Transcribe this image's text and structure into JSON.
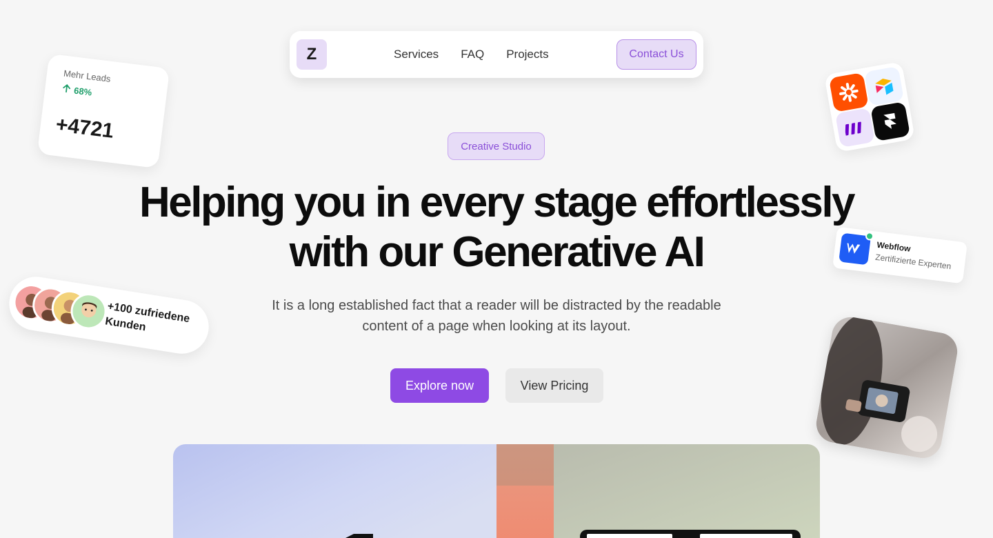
{
  "nav": {
    "logo_letter": "Z",
    "links": [
      "Services",
      "FAQ",
      "Projects"
    ],
    "contact_label": "Contact Us"
  },
  "hero": {
    "badge": "Creative Studio",
    "headline_line1": "Helping you in every stage effortlessly",
    "headline_line2": "with our Generative AI",
    "subtext": "It is a long established fact that a reader will be distracted by the readable content of a page when looking at its layout.",
    "primary_button": "Explore now",
    "secondary_button": "View Pricing"
  },
  "leads_card": {
    "title": "Mehr Leads",
    "percent": "68%",
    "value": "+4721"
  },
  "customers_card": {
    "text": "+100 zufriedene Kunden"
  },
  "webflow_card": {
    "title": "Webflow",
    "subtitle": "Zertifizierte Experten"
  },
  "apps": [
    "zapier-icon",
    "airtable-icon",
    "make-icon",
    "framer-icon"
  ],
  "colors": {
    "accent": "#8e4ae4",
    "accent_soft": "#e7dcf7",
    "background": "#f6f6f6",
    "positive": "#1e9e6a"
  }
}
